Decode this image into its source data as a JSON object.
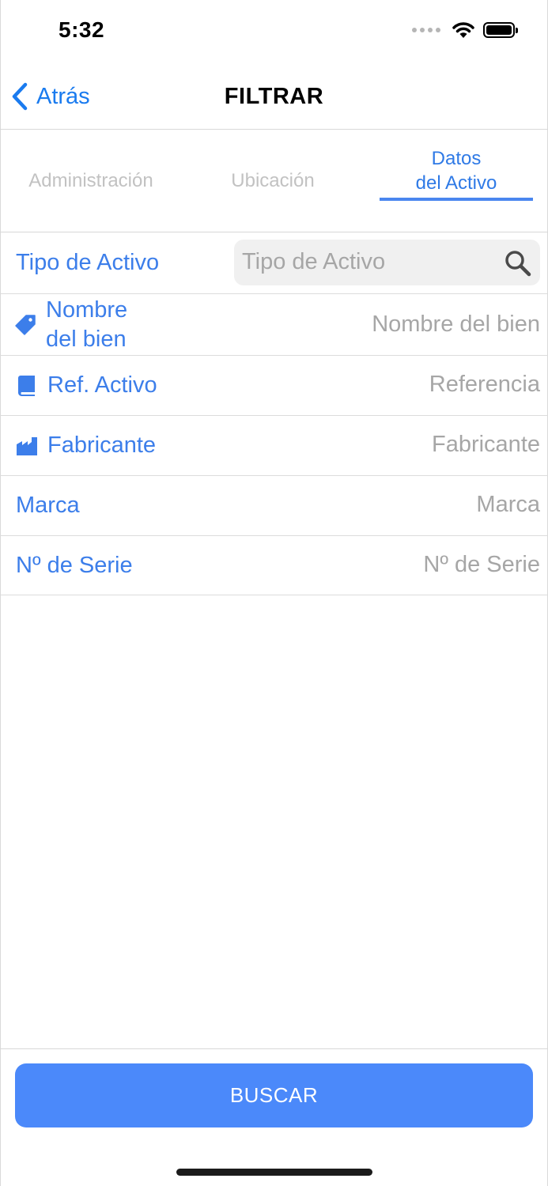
{
  "status_bar": {
    "time": "5:32"
  },
  "nav": {
    "back_label": "Atrás",
    "title": "FILTRAR"
  },
  "tabs": [
    {
      "label": "Administración",
      "active": false
    },
    {
      "label": "Ubicación",
      "active": false
    },
    {
      "label_line1": "Datos",
      "label_line2": "del Activo",
      "active": true
    }
  ],
  "form": {
    "tipo_activo": {
      "label": "Tipo de Activo",
      "placeholder": "Tipo de Activo"
    },
    "nombre_bien": {
      "label_line1": "Nombre",
      "label_line2": "del bien",
      "placeholder": "Nombre del bien",
      "icon": "tag-icon"
    },
    "ref_activo": {
      "label": "Ref. Activo",
      "placeholder": "Referencia",
      "icon": "book-icon"
    },
    "fabricante": {
      "label": "Fabricante",
      "placeholder": "Fabricante",
      "icon": "factory-icon"
    },
    "marca": {
      "label": "Marca",
      "placeholder": "Marca"
    },
    "serie": {
      "label": "Nº de Serie",
      "placeholder": "Nº de Serie"
    }
  },
  "actions": {
    "search_label": "BUSCAR"
  },
  "colors": {
    "accent": "#3c7eea",
    "button": "#4b89fa",
    "inactive_tab": "#c2c2c2",
    "placeholder": "#a6a6a6"
  }
}
